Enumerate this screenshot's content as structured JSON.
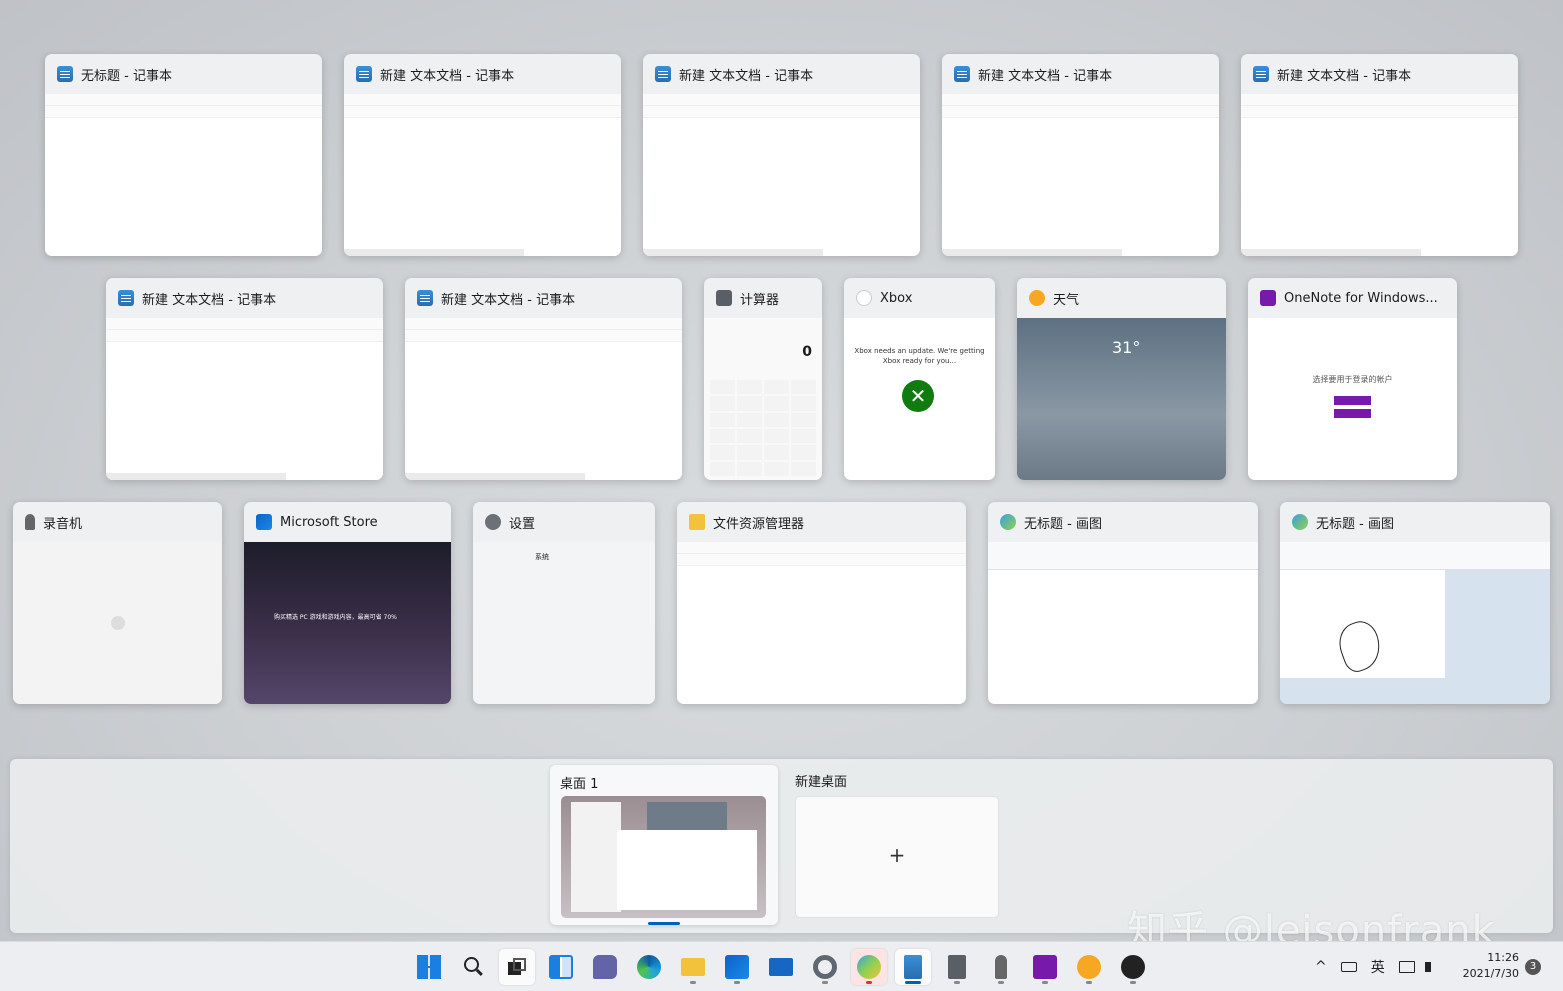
{
  "rows": [
    [
      {
        "title": "无标题 - 记事本",
        "icon": "notepad-icon"
      },
      {
        "title": "新建 文本文档 - 记事本",
        "icon": "notepad-icon"
      },
      {
        "title": "新建 文本文档 - 记事本",
        "icon": "notepad-icon"
      },
      {
        "title": "新建 文本文档 - 记事本",
        "icon": "notepad-icon"
      },
      {
        "title": "新建 文本文档 - 记事本",
        "icon": "notepad-icon"
      }
    ],
    [
      {
        "title": "新建 文本文档 - 记事本",
        "icon": "notepad-icon"
      },
      {
        "title": "新建 文本文档 - 记事本",
        "icon": "notepad-icon"
      },
      {
        "title": "计算器",
        "icon": "calculator-icon",
        "display": "0"
      },
      {
        "title": "Xbox",
        "icon": "xbox-icon",
        "message": "Xbox needs an update. We're getting Xbox ready for you..."
      },
      {
        "title": "天气",
        "icon": "weather-icon",
        "temperature": "31°"
      },
      {
        "title": "OneNote for Windows...",
        "icon": "onenote-icon",
        "prompt": "选择要用于登录的帐户"
      }
    ],
    [
      {
        "title": "录音机",
        "icon": "microphone-icon"
      },
      {
        "title": "Microsoft Store",
        "icon": "store-icon",
        "banner": "购买精选 PC 游戏和游戏内容，最高可省 70%"
      },
      {
        "title": "设置",
        "icon": "gear-icon",
        "section": "系统"
      },
      {
        "title": "文件资源管理器",
        "icon": "folder-icon"
      },
      {
        "title": "无标题 - 画图",
        "icon": "paint-icon"
      },
      {
        "title": "无标题 - 画图",
        "icon": "paint-icon"
      }
    ]
  ],
  "desktops": {
    "current": "桌面 1",
    "new_label": "新建桌面",
    "plus": "+"
  },
  "watermark": "知乎 @leisonfrank",
  "taskbar": {
    "apps": [
      "start-icon",
      "search-icon",
      "task-view-icon",
      "widgets-icon",
      "chat-icon",
      "edge-icon",
      "file-explorer-icon",
      "store-icon",
      "mail-icon",
      "settings-icon",
      "paint-icon",
      "notepad-icon",
      "calculator-icon",
      "voice-recorder-icon",
      "onenote-icon",
      "weather-icon",
      "xbox-icon"
    ],
    "tray": {
      "chevron": "^",
      "ime": "英",
      "clock_time": "11:26",
      "clock_date": "2021/7/30",
      "notifications": "3"
    }
  }
}
